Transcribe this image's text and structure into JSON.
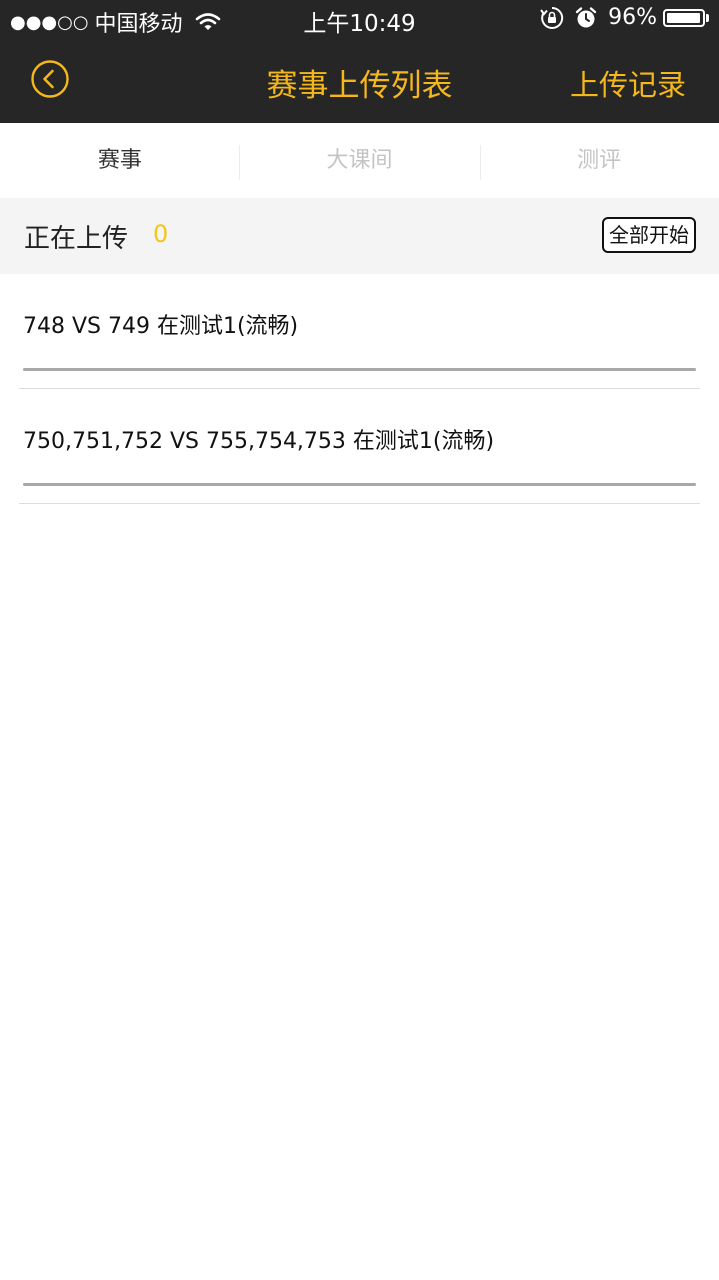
{
  "status_bar": {
    "signal": "●●●○○",
    "carrier": "中国移动",
    "time": "上午10:49",
    "battery_percent_text": "96%",
    "battery_level": 0.96
  },
  "nav": {
    "title": "赛事上传列表",
    "right_label": "上传记录",
    "back_icon": "chevron-left-circle-icon",
    "accent_color": "#f5b81c"
  },
  "tabs": [
    {
      "label": "赛事",
      "active": true
    },
    {
      "label": "大课间",
      "active": false
    },
    {
      "label": "测评",
      "active": false
    }
  ],
  "section": {
    "label": "正在上传",
    "count": "0",
    "start_all_label": "全部开始"
  },
  "uploads": [
    {
      "title": "748 VS 749 在测试1(流畅)",
      "progress": 0
    },
    {
      "title": "750,751,752 VS 755,754,753 在测试1(流畅)",
      "progress": 0
    }
  ]
}
